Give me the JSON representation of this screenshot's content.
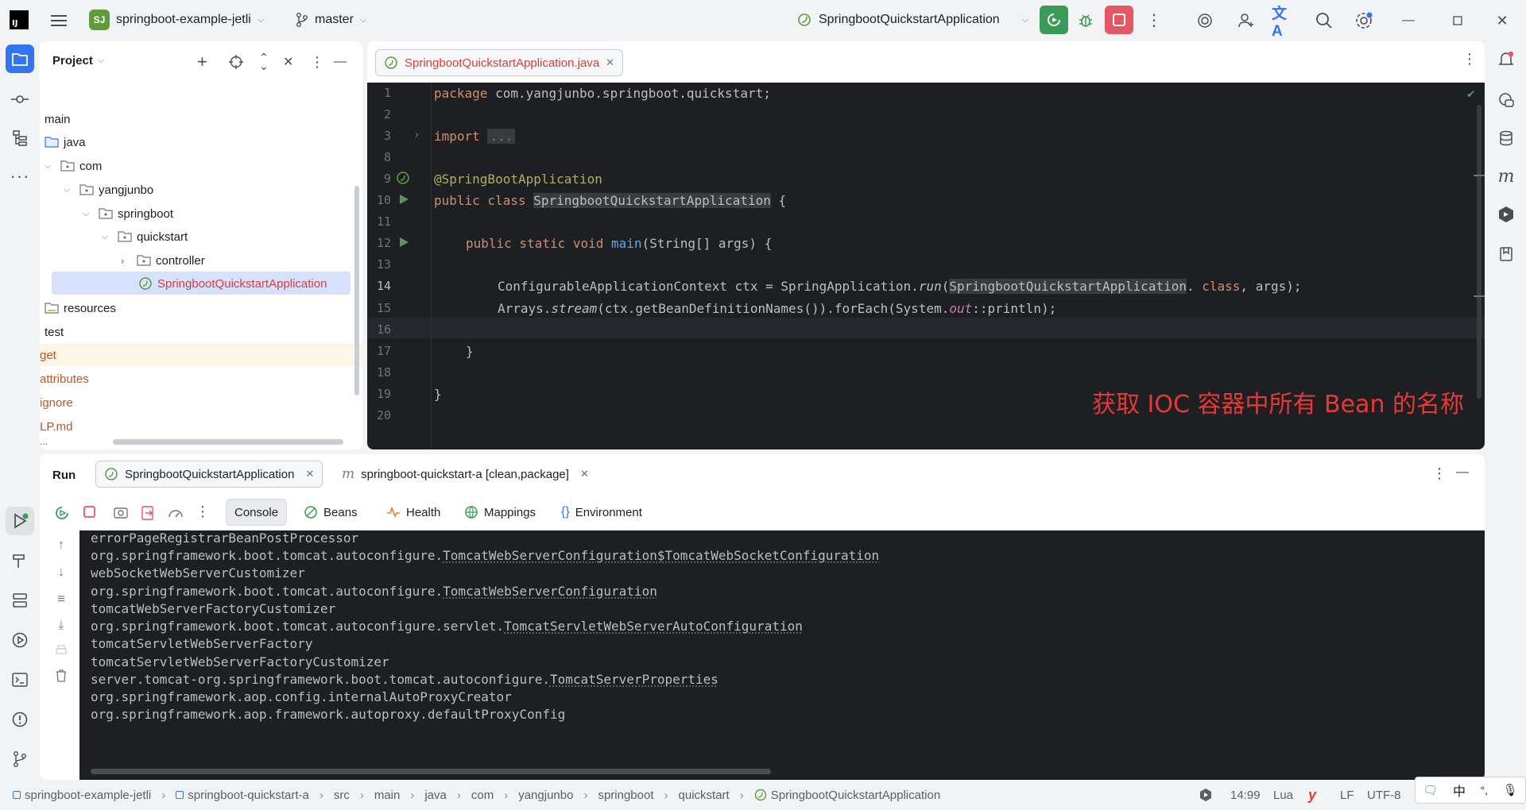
{
  "titlebar": {
    "project_badge": "SJ",
    "project_name": "springboot-example-jetli",
    "branch": "master",
    "run_config": "SpringbootQuickstartApplication",
    "accent_run": "#3a9a57",
    "accent_stop": "#e55765"
  },
  "project_panel": {
    "title": "Project",
    "tree": [
      {
        "label": "main",
        "kind": "folder-plain"
      },
      {
        "label": "java",
        "kind": "folder-src"
      },
      {
        "label": "com",
        "kind": "package"
      },
      {
        "label": "yangjunbo",
        "kind": "package"
      },
      {
        "label": "springboot",
        "kind": "package"
      },
      {
        "label": "quickstart",
        "kind": "package"
      },
      {
        "label": "controller",
        "kind": "package"
      },
      {
        "label": "SpringbootQuickstartApplication",
        "kind": "spring-class"
      },
      {
        "label": "resources",
        "kind": "folder-res"
      },
      {
        "label": "test",
        "kind": "folder-plain"
      },
      {
        "label": "get",
        "kind": "file"
      },
      {
        "label": "attributes",
        "kind": "file"
      },
      {
        "label": "ignore",
        "kind": "file"
      },
      {
        "label": "LP.md",
        "kind": "file"
      },
      {
        "label": "...",
        "kind": "file"
      }
    ]
  },
  "editor": {
    "tab_label": "SpringbootQuickstartApplication.java",
    "line_numbers": [
      "1",
      "2",
      "3",
      "8",
      "9",
      "10",
      "11",
      "12",
      "13",
      "14",
      "15",
      "16",
      "17",
      "18",
      "19",
      "20"
    ],
    "code": {
      "l1_kw": "package",
      "l1_rest": " com.yangjunbo.springboot.quickstart;",
      "l3_kw": "import",
      "l3_fold": "...",
      "l9_ann": "@SpringBootApplication",
      "l10_kw": "public class",
      "l10_cls": "SpringbootQuickstartApplication",
      "l10_rest": " {",
      "l12_kw": "public static void",
      "l12_fn": "main",
      "l12_rest": "(String[] args) {",
      "l14_a": "ConfigurableApplicationContext ctx = SpringApplication.",
      "l14_run": "run",
      "l14_b": "(",
      "l14_cls": "SpringbootQuickstartApplication",
      "l14_c": ". ",
      "l14_kw": "class",
      "l14_d": ", args);",
      "l15_a": "Arrays.",
      "l15_stream": "stream",
      "l15_b": "(ctx.getBeanDefinitionNames()).forEach(System.",
      "l15_out": "out",
      "l15_c": "::println);",
      "l17": "}",
      "l19": "}"
    },
    "annotation_note": "获取 IOC 容器中所有 Bean 的名称"
  },
  "run_panel": {
    "title": "Run",
    "tab1": "SpringbootQuickstartApplication",
    "tab2": "springboot-quickstart-a [clean,package]",
    "subtabs": {
      "console": "Console",
      "beans": "Beans",
      "health": "Health",
      "mappings": "Mappings",
      "environment": "Environment"
    },
    "console_lines": [
      {
        "prefix": "errorPageRegistrarBeanPostProcessor",
        "link": ""
      },
      {
        "prefix": "org.springframework.boot.tomcat.autoconfigure.",
        "link": "TomcatWebServerConfiguration$TomcatWebSocketConfiguration"
      },
      {
        "prefix": "webSocketWebServerCustomizer",
        "link": ""
      },
      {
        "prefix": "org.springframework.boot.tomcat.autoconfigure.",
        "link": "TomcatWebServerConfiguration"
      },
      {
        "prefix": "tomcatWebServerFactoryCustomizer",
        "link": ""
      },
      {
        "prefix": "org.springframework.boot.tomcat.autoconfigure.servlet.",
        "link": "TomcatServletWebServerAutoConfiguration"
      },
      {
        "prefix": "tomcatServletWebServerFactory",
        "link": ""
      },
      {
        "prefix": "tomcatServletWebServerFactoryCustomizer",
        "link": ""
      },
      {
        "prefix": "server.tomcat-org.springframework.boot.tomcat.autoconfigure.",
        "link": "TomcatServerProperties"
      },
      {
        "prefix": "org.springframework.aop.config.internalAutoProxyCreator",
        "link": ""
      },
      {
        "prefix": "org.springframework.aop.framework.autoproxy.defaultProxyConfig",
        "link": ""
      }
    ]
  },
  "statusbar": {
    "crumbs": [
      "springboot-example-jetli",
      "springboot-quickstart-a",
      "src",
      "main",
      "java",
      "com",
      "yangjunbo",
      "springboot",
      "quickstart",
      "SpringbootQuickstartApplication"
    ],
    "position": "14:99",
    "language": "Lua",
    "line_sep": "LF",
    "encoding": "UTF-8",
    "ime_lang": "中"
  }
}
